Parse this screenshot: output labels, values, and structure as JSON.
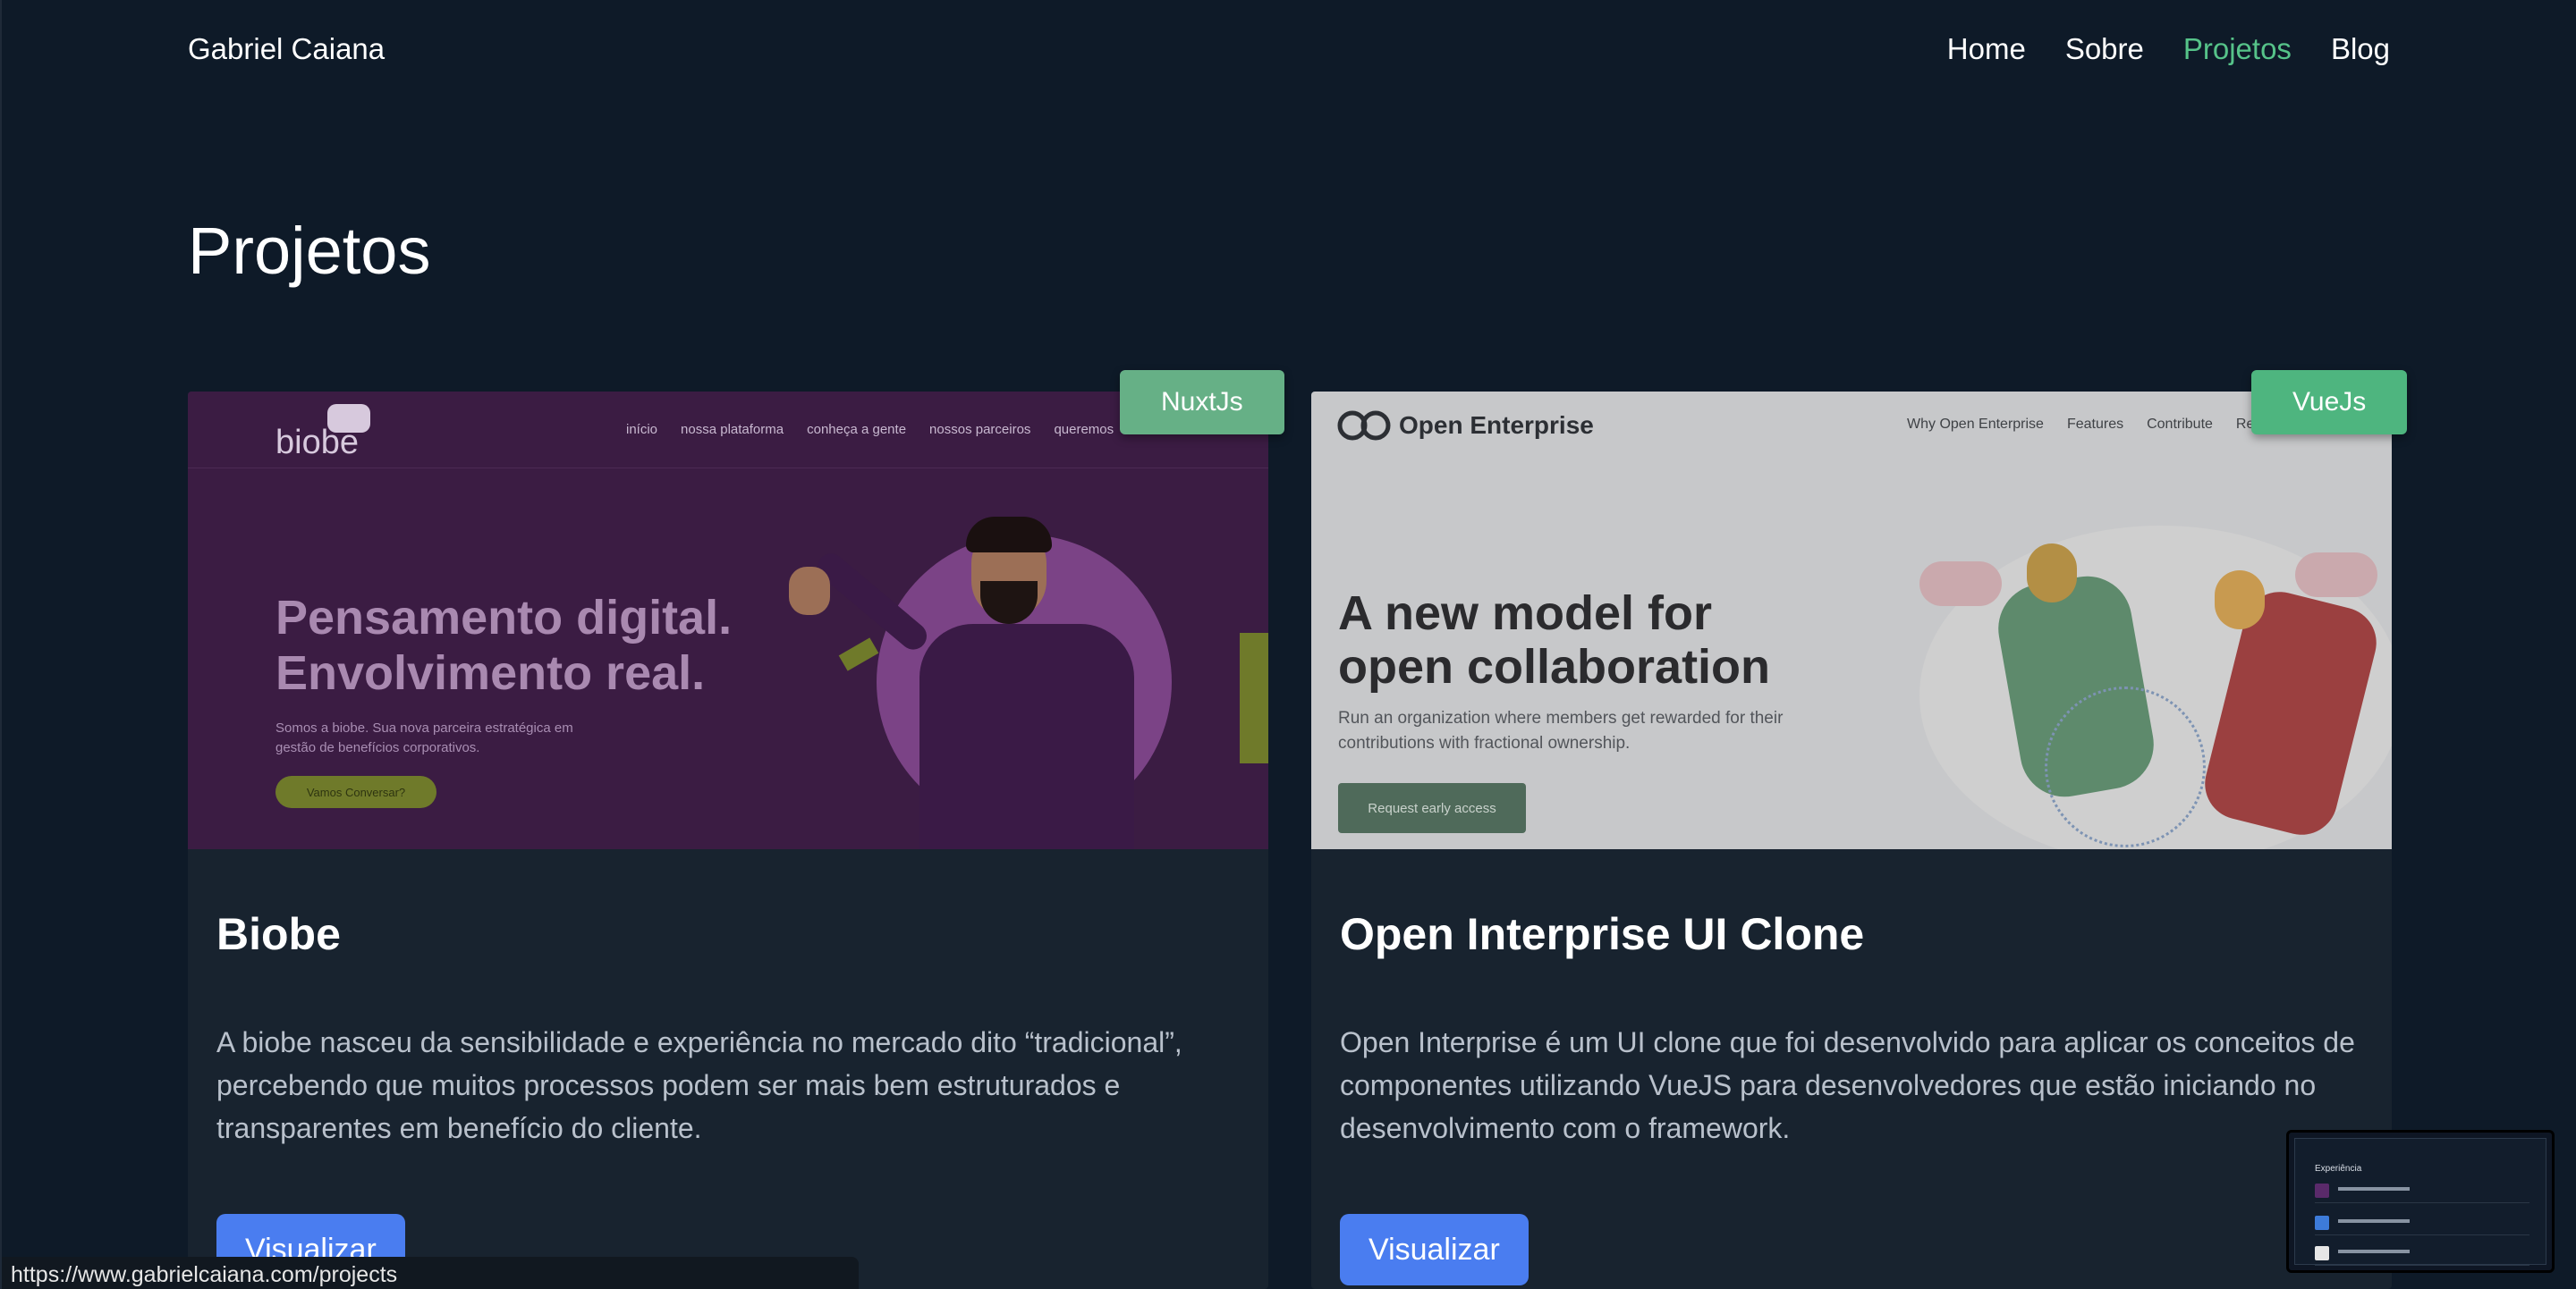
{
  "header": {
    "brand": "Gabriel Caiana",
    "nav": [
      {
        "label": "Home",
        "active": false
      },
      {
        "label": "Sobre",
        "active": false
      },
      {
        "label": "Projetos",
        "active": true
      },
      {
        "label": "Blog",
        "active": false
      }
    ]
  },
  "main": {
    "title": "Projetos",
    "projects": [
      {
        "tag": "NuxtJs",
        "title": "Biobe",
        "description": "A biobe nasceu da sensibilidade e experiência no mercado dito “tradicional”, percebendo que muitos processos podem ser mais bem estruturados e transparentes em benefício do cliente.",
        "button": "Visualizar",
        "preview": {
          "logo": "biobe",
          "links": [
            "início",
            "nossa plataforma",
            "conheça a gente",
            "nossos parceiros",
            "queremos"
          ],
          "headline_1": "Pensamento digital.",
          "headline_2": "Envolvimento real.",
          "sub": "Somos a biobe. Sua nova parceira estratégica em gestão de benefícios corporativos.",
          "cta": "Vamos Conversar?"
        }
      },
      {
        "tag": "VueJs",
        "title": "Open Interprise UI Clone",
        "description": "Open Interprise é um UI clone que foi desenvolvido para aplicar os conceitos de componentes utilizando VueJS para desenvolvedores que estão iniciando no desenvolvimento com o framework.",
        "button": "Visualizar",
        "preview": {
          "logo": "Open Enterprise",
          "links": [
            "Why Open Enterprise",
            "Features",
            "Contribute",
            "Re"
          ],
          "headline_1": "A new model for",
          "headline_2": "open collaboration",
          "sub": "Run an organization where members get rewarded for their contributions with fractional ownership.",
          "cta": "Request early access"
        }
      }
    ]
  },
  "status_bar": {
    "url": "https://www.gabrielcaiana.com/projects"
  },
  "mini_preview": {
    "heading": "Experiência"
  },
  "colors": {
    "background": "#0e1a28",
    "card": "#18232f",
    "accent_green": "#56c389",
    "button_blue": "#4a7df0"
  }
}
